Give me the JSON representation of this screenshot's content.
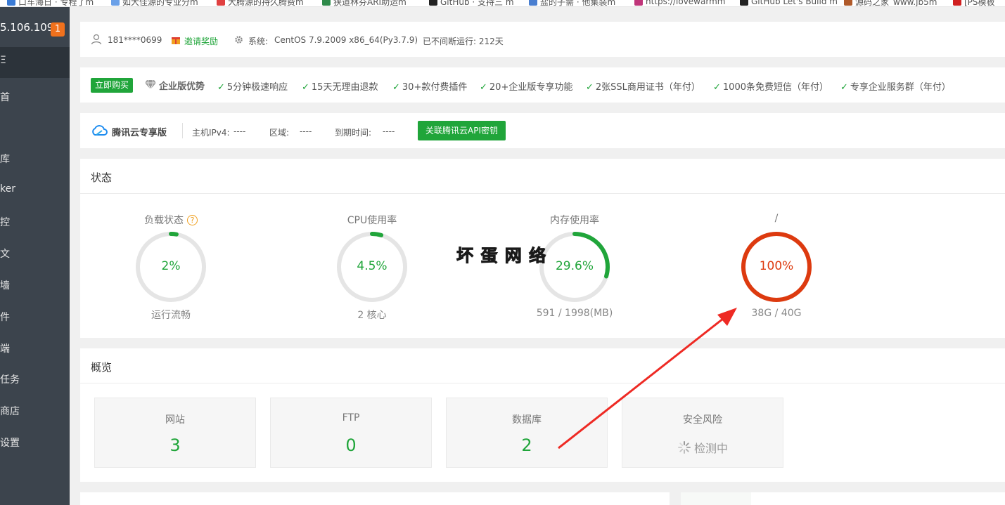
{
  "bookmarks": [
    "口车海日 · 专程了m",
    "如大佳源的专业分m",
    "大腾源的持久腾费m",
    "狭道林芬ARI助运m",
    "GitHub · 支持三 m",
    "盐的子需 · 他集装m",
    "https://lovewarmm",
    "GitHub Let's Build m",
    "源码之家_www.jb5m",
    "[PS模板"
  ],
  "sidebar": {
    "server_ip": "5.106.109",
    "badge": "1",
    "items": [
      "Ξ",
      "首",
      "库",
      "ker",
      "控",
      "文",
      "墙",
      "件",
      "端",
      "任务",
      "商店",
      "设置"
    ]
  },
  "top_bar": {
    "user": "181****0699",
    "invite": "邀请奖励",
    "system_label": "系统:",
    "system_value": "CentOS 7.9.2009 x86_64(Py3.7.9)",
    "uptime": "已不间断运行: 212天"
  },
  "enterprise": {
    "buy_button": "立即购买",
    "title": "企业版优势",
    "features": [
      "5分钟极速响应",
      "15天无理由退款",
      "30+款付费插件",
      "20+企业版专享功能",
      "2张SSL商用证书（年付）",
      "1000条免费短信（年付）",
      "专享企业服务群（年付）"
    ]
  },
  "tencent": {
    "title": "腾讯云专享版",
    "ipv4_label": "主机IPv4:",
    "ipv4_value": "----",
    "region_label": "区域:",
    "region_value": "----",
    "expire_label": "到期时间:",
    "expire_value": "----",
    "api_button": "关联腾讯云API密钥"
  },
  "status": {
    "title": "状态",
    "gauges": [
      {
        "title": "负载状态",
        "value": "2%",
        "sub": "运行流畅",
        "percent": 2,
        "color": "#20a53a"
      },
      {
        "title": "CPU使用率",
        "value": "4.5%",
        "sub": "2 核心",
        "percent": 4.5,
        "color": "#20a53a"
      },
      {
        "title": "内存使用率",
        "value": "29.6%",
        "sub": "591 / 1998(MB)",
        "percent": 29.6,
        "color": "#20a53a"
      },
      {
        "title": "/",
        "value": "100%",
        "sub": "38G / 40G",
        "percent": 100,
        "color": "#dd3a0f"
      }
    ]
  },
  "overview": {
    "title": "概览",
    "items": [
      {
        "label": "网站",
        "value": "3"
      },
      {
        "label": "FTP",
        "value": "0"
      },
      {
        "label": "数据库",
        "value": "2"
      },
      {
        "label": "安全风险",
        "value": "检测中"
      }
    ]
  },
  "watermark": "坏 蛋 网 络",
  "colors": {
    "green": "#20a53a",
    "red": "#dd3a0f",
    "sidebar": "#3c444d",
    "orange": "#f0711d"
  }
}
